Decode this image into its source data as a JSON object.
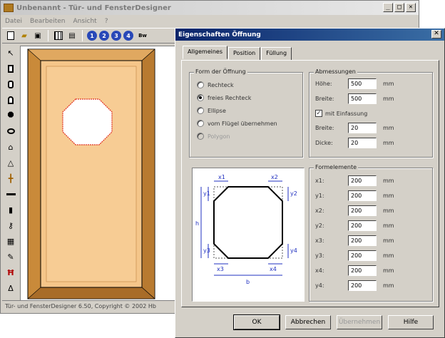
{
  "main_window": {
    "title": "Unbenannt - Tür- und FensterDesigner",
    "controls": [
      "_",
      "□",
      "✕"
    ]
  },
  "menu": [
    "Datei",
    "Bearbeiten",
    "Ansicht",
    "?"
  ],
  "toolbar": {
    "icons": [
      "new-document-icon",
      "open-folder-icon",
      "save-icon",
      "grid-icon",
      "list-icon",
      "zoom-1-icon",
      "zoom-2-icon",
      "zoom-3-icon",
      "zoom-fit-icon"
    ],
    "zoom_labels": [
      "1",
      "2",
      "3",
      "4"
    ],
    "zoom_fit_label": "Bw"
  },
  "left_tools": [
    "pointer-tool-icon",
    "rectangle-tool-icon",
    "rounded-rect-tool-icon",
    "arch-tool-icon",
    "octagon-tool-icon",
    "ellipse-tool-icon",
    "drop-tool-icon",
    "drop-small-tool-icon",
    "crossbar-tool-icon",
    "bar-tool-icon",
    "handle-tool-icon",
    "key-tool-icon",
    "hinge-tool-icon",
    "paint-tool-icon",
    "dimension-tool-icon",
    "measure-tool-icon"
  ],
  "statusbar": {
    "text": "Tür- und FensterDesigner 6.50, Copyright © 2002 Hb"
  },
  "dialog": {
    "title": "Eigenschaften Öffnung",
    "close": "✕",
    "tabs": [
      {
        "label": "Allgemeines",
        "active": true
      },
      {
        "label": "Position",
        "active": false
      },
      {
        "label": "Füllung",
        "active": false
      }
    ],
    "shape_group": {
      "legend": "Form der Öffnung",
      "options": [
        {
          "label": "Rechteck",
          "checked": false,
          "enabled": true
        },
        {
          "label": "freies Rechteck",
          "checked": true,
          "enabled": true
        },
        {
          "label": "Ellipse",
          "checked": false,
          "enabled": true
        },
        {
          "label": "vom Flügel übernehmen",
          "checked": false,
          "enabled": true
        },
        {
          "label": "Polygon",
          "checked": false,
          "enabled": false
        }
      ]
    },
    "dims_group": {
      "legend": "Abmessungen",
      "rows": [
        {
          "label": "Höhe:",
          "value": "500",
          "unit": "mm"
        },
        {
          "label": "Breite:",
          "value": "500",
          "unit": "mm"
        }
      ],
      "frame_checkbox": {
        "label": "mit Einfassung",
        "checked": true,
        "mark": "✓"
      },
      "frame_rows": [
        {
          "label": "Breite:",
          "value": "20",
          "unit": "mm"
        },
        {
          "label": "Dicke:",
          "value": "20",
          "unit": "mm"
        }
      ]
    },
    "form_group": {
      "legend": "Formelemente",
      "rows": [
        {
          "label": "x1:",
          "value": "200",
          "unit": "mm"
        },
        {
          "label": "y1:",
          "value": "200",
          "unit": "mm"
        },
        {
          "label": "x2:",
          "value": "200",
          "unit": "mm"
        },
        {
          "label": "y2:",
          "value": "200",
          "unit": "mm"
        },
        {
          "label": "x3:",
          "value": "200",
          "unit": "mm"
        },
        {
          "label": "y3:",
          "value": "200",
          "unit": "mm"
        },
        {
          "label": "x4:",
          "value": "200",
          "unit": "mm"
        },
        {
          "label": "y4:",
          "value": "200",
          "unit": "mm"
        }
      ]
    },
    "diagram": {
      "labels": [
        "x1",
        "x2",
        "y1",
        "y2",
        "h",
        "y3",
        "y4",
        "x3",
        "x4",
        "b"
      ]
    },
    "buttons": {
      "ok": "OK",
      "cancel": "Abbrechen",
      "apply": "Übernehmen",
      "help": "Hilfe"
    }
  },
  "colors": {
    "door_wood": "#f5c68a",
    "door_frame": "#c98a3a",
    "dialog_title": "#0a246a",
    "diagram_blue": "#2030c0"
  }
}
